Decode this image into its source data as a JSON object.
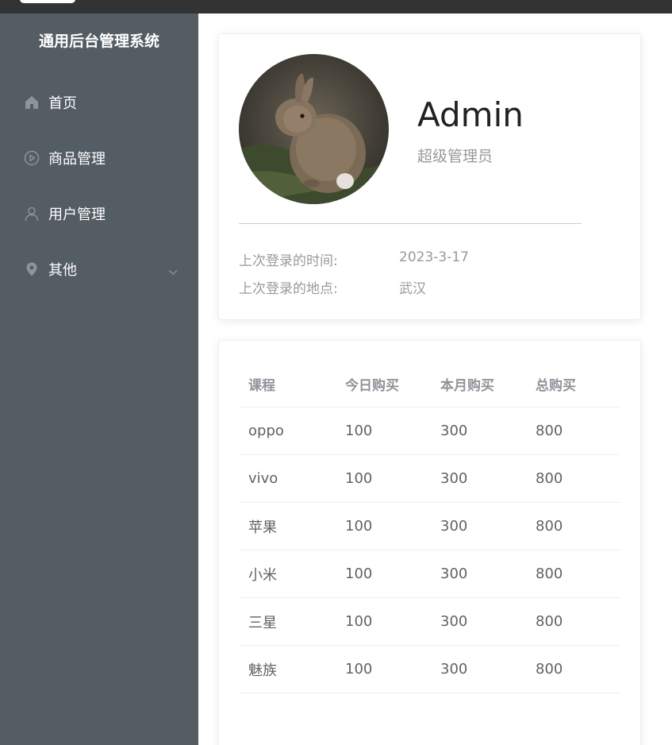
{
  "app": {
    "title": "通用后台管理系统"
  },
  "sidebar": {
    "items": [
      {
        "label": "首页",
        "icon": "home-icon"
      },
      {
        "label": "商品管理",
        "icon": "video-play-icon"
      },
      {
        "label": "用户管理",
        "icon": "user-icon"
      },
      {
        "label": "其他",
        "icon": "location-icon",
        "has_submenu": true
      }
    ]
  },
  "user": {
    "name": "Admin",
    "role": "超级管理员",
    "last_login_time_label": "上次登录的时间:",
    "last_login_time": "2023-3-17",
    "last_login_place_label": "上次登录的地点:",
    "last_login_place": "武汉"
  },
  "table": {
    "headers": [
      "课程",
      "今日购买",
      "本月购买",
      "总购买"
    ],
    "rows": [
      [
        "oppo",
        "100",
        "300",
        "800"
      ],
      [
        "vivo",
        "100",
        "300",
        "800"
      ],
      [
        "苹果",
        "100",
        "300",
        "800"
      ],
      [
        "小米",
        "100",
        "300",
        "800"
      ],
      [
        "三星",
        "100",
        "300",
        "800"
      ],
      [
        "魅族",
        "100",
        "300",
        "800"
      ]
    ]
  },
  "colors": {
    "sidebar_bg": "#545c64",
    "topbar_bg": "#333333",
    "text_muted": "#999999"
  }
}
